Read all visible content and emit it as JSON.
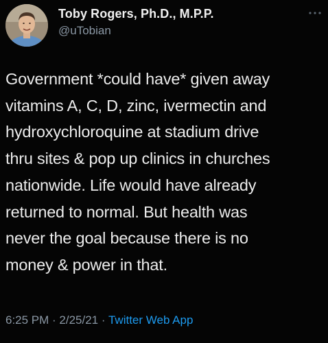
{
  "author": {
    "name": "Toby Rogers, Ph.D., M.P.P.",
    "handle": "@uTobian"
  },
  "tweet": {
    "lines": [
      "Government *could have* given away",
      "vitamins A, C, D, zinc, ivermectin and",
      "hydroxychloroquine at stadium drive",
      "thru sites & pop up clinics in churches",
      "nationwide. Life would have already",
      "returned to normal. But health was",
      "never the goal because there is no",
      "money & power in that."
    ]
  },
  "meta": {
    "time": "6:25 PM",
    "separator1": " · ",
    "date": "2/25/21",
    "separator2": " · ",
    "source": "Twitter Web App"
  },
  "icons": {
    "more": "more-dots-icon",
    "avatar": "profile-photo"
  },
  "colors": {
    "background": "#000000",
    "text": "#ececec",
    "secondary": "#8b98a5",
    "link": "#1d9bf0"
  }
}
